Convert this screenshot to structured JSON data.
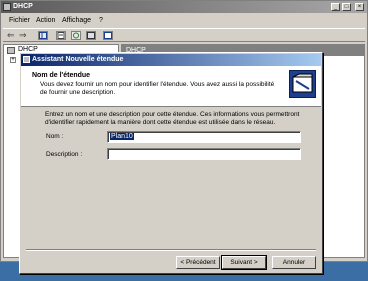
{
  "main_window": {
    "title": "DHCP",
    "controls": [
      "_",
      "□",
      "×"
    ]
  },
  "menubar": {
    "items": [
      "Fichier",
      "Action",
      "Affichage",
      "?"
    ]
  },
  "toolbar": {
    "back_glyph": "⇐",
    "forward_glyph": "⇒",
    "icons": [
      "console-icon",
      "properties-icon",
      "refresh-icon",
      "export-icon",
      "help-icon"
    ]
  },
  "tree": {
    "root_label": "DHCP"
  },
  "right_pane": {
    "header": "DHCP"
  },
  "wizard": {
    "title": "Assistant Nouvelle étendue",
    "heading": "Nom de l'étendue",
    "subheading": "Vous devez fournir un nom pour identifier l'étendue. Vous avez aussi la possibilité de fournir une description.",
    "body": "Entrez un nom et une description pour cette étendue. Ces informations vous permettront d'identifier rapidement la manière dont cette étendue est utilisée dans le réseau.",
    "name_label": "Nom :",
    "name_value": "Plan10",
    "description_label": "Description :",
    "description_value": "",
    "buttons": {
      "back": "< Précédent",
      "next": "Suivant >",
      "cancel": "Annuler"
    }
  },
  "colors": {
    "desktop": "#3a6ea5",
    "wizard_titlebar": "#0a246a",
    "main_titlebar": "#5a5a5a"
  }
}
